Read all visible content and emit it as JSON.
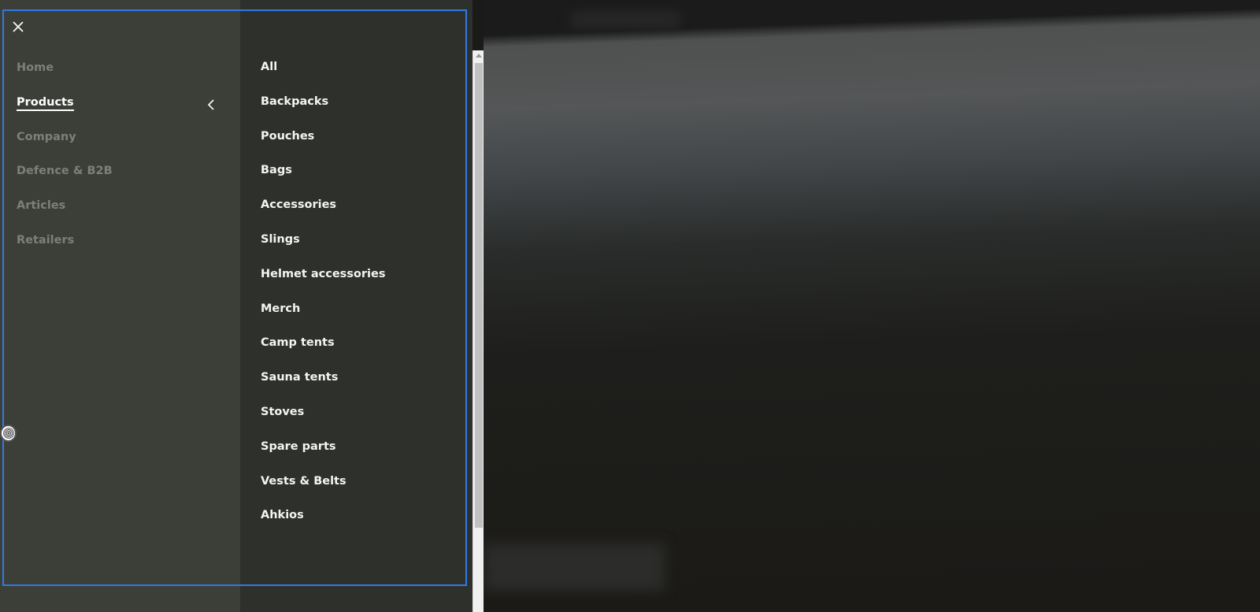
{
  "menu": {
    "close_icon": "close-icon",
    "main_items": [
      {
        "label": "Home",
        "active": false
      },
      {
        "label": "Products",
        "active": true
      },
      {
        "label": "Company",
        "active": false
      },
      {
        "label": "Defence & B2B",
        "active": false
      },
      {
        "label": "Articles",
        "active": false
      },
      {
        "label": "Retailers",
        "active": false
      }
    ],
    "back_icon": "chevron-left-icon",
    "sub_items": [
      "All",
      "Backpacks",
      "Pouches",
      "Bags",
      "Accessories",
      "Slings",
      "Helmet accessories",
      "Merch",
      "Camp tents",
      "Sauna tents",
      "Stoves",
      "Spare parts",
      "Vests & Belts",
      "Ahkios"
    ]
  },
  "colors": {
    "focus_outline": "#2f7ae5",
    "panel_left": "#3c3e38",
    "panel_right": "#2e302b"
  }
}
